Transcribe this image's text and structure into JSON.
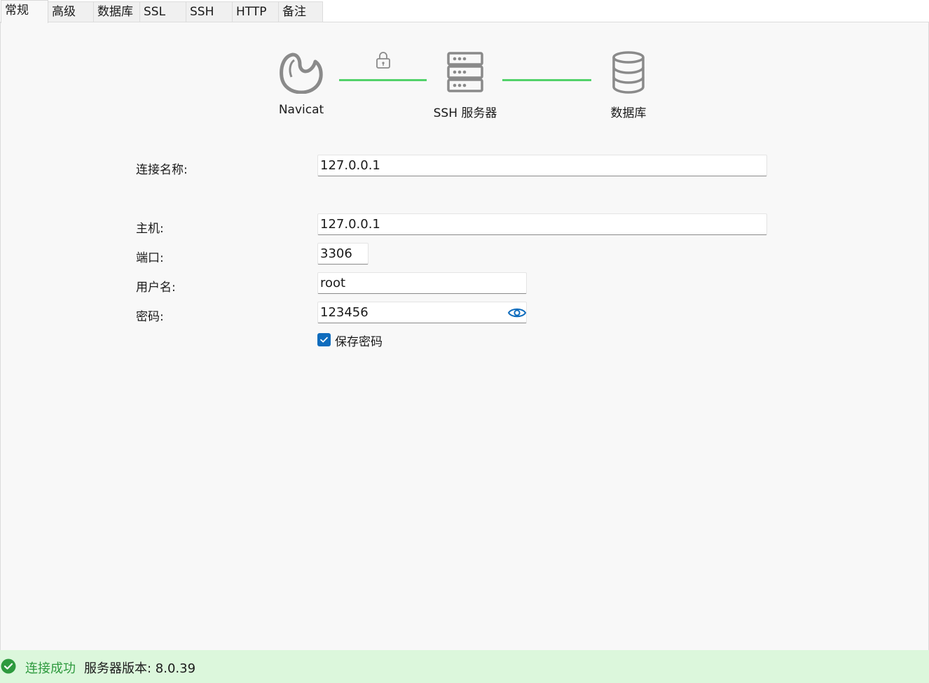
{
  "tabs": [
    {
      "label": "常规",
      "active": true
    },
    {
      "label": "高级"
    },
    {
      "label": "数据库"
    },
    {
      "label": "SSL"
    },
    {
      "label": "SSH"
    },
    {
      "label": "HTTP"
    },
    {
      "label": "备注"
    }
  ],
  "diagram": {
    "client_label": "Navicat",
    "ssh_label": "SSH 服务器",
    "db_label": "数据库",
    "line_color": "#52d26a"
  },
  "form": {
    "conn_name_label": "连接名称:",
    "conn_name_value": "127.0.0.1",
    "host_label": "主机:",
    "host_value": "127.0.0.1",
    "port_label": "端口:",
    "port_value": "3306",
    "user_label": "用户名:",
    "user_value": "root",
    "password_label": "密码:",
    "password_value": "123456",
    "save_password_label": "保存密码",
    "save_password_checked": true
  },
  "status": {
    "result": "连接成功",
    "version": "服务器版本: 8.0.39",
    "success_color": "#2e9a3e"
  },
  "colors": {
    "accent": "#0f6cbd",
    "status_bg": "#dcf7dc"
  }
}
